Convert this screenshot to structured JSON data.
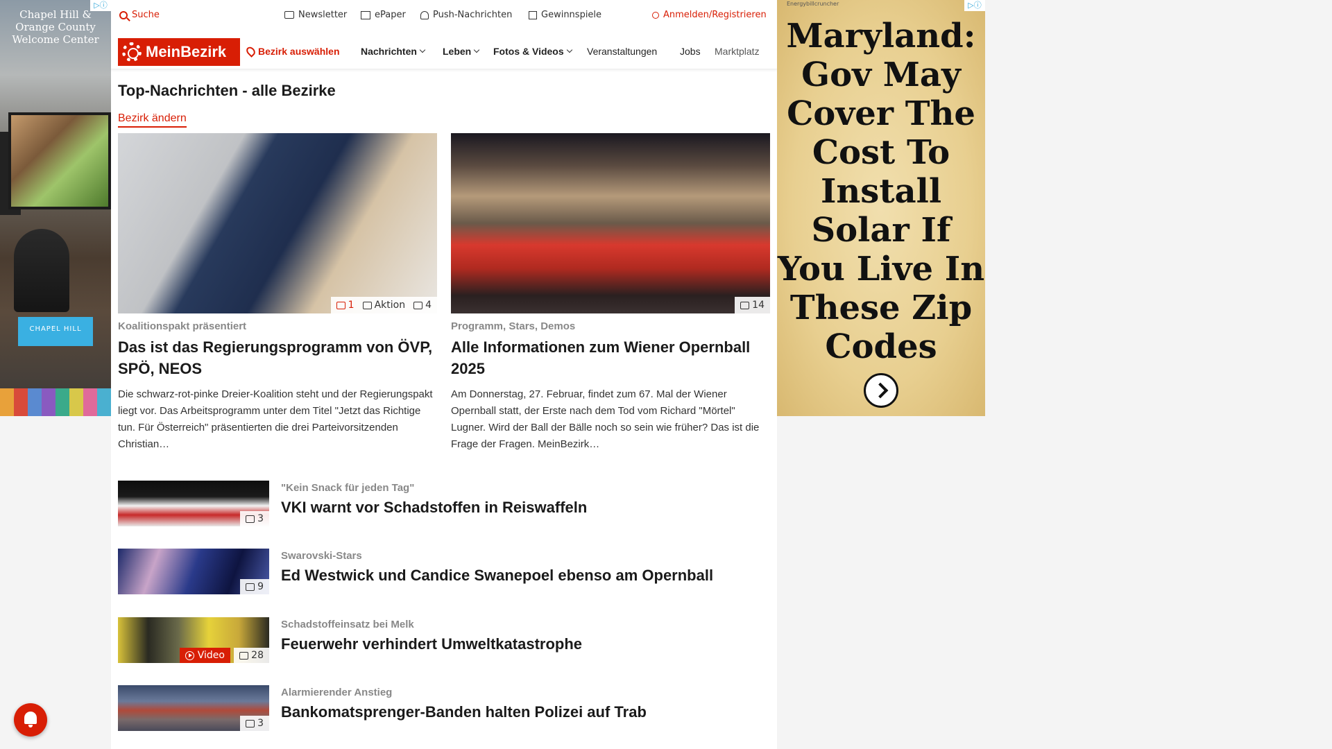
{
  "left_ad": {
    "title": "Chapel Hill & Orange County Welcome Center",
    "logo": "CHAPEL HILL",
    "adchoice": "▷ⓘ",
    "stripe_colors": [
      "#e8a13a",
      "#d84a3a",
      "#5a8ad0",
      "#8a5ac0",
      "#3aaa8a",
      "#d8c84a",
      "#e06a9a",
      "#4ab0d0"
    ]
  },
  "topbar": {
    "search": "Suche",
    "newsletter": "Newsletter",
    "epaper": "ePaper",
    "push": "Push-Nachrichten",
    "gewinnspiele": "Gewinnspiele",
    "login": "Anmelden/Registrieren"
  },
  "nav": {
    "logo": "MeinBezirk",
    "bezirk": "Bezirk auswählen",
    "items": [
      "Nachrichten",
      "Leben",
      "Fotos & Videos",
      "Veranstaltungen",
      "Jobs",
      "Marktplatz"
    ]
  },
  "page": {
    "title": "Top-Nachrichten - alle Bezirke",
    "bezirk_link": "Bezirk ändern"
  },
  "cards": [
    {
      "kicker": "Koalitionspakt präsentiert",
      "headline": "Das ist das Regierungsprogramm von ÖVP, SPÖ, NEOS",
      "teaser": "Die schwarz-rot-pinke Dreier-Koalition steht und der Regierungspakt liegt vor. Das Arbeitsprogramm unter dem Titel \"Jetzt das Richtige tun. Für Österreich\" präsentierten die drei Parteivorsitzenden Christian…",
      "comments": "1",
      "aktion": "Aktion",
      "photos": "4"
    },
    {
      "kicker": "Programm, Stars, Demos",
      "headline": "Alle Informationen zum Wiener Opernball 2025",
      "teaser": "Am Donnerstag, 27. Februar, findet zum 67. Mal der Wiener Opernball statt, der Erste nach dem Tod vom Richard \"Mörtel\" Lugner. Wird der Ball der Bälle noch so sein wie früher? Das ist die Frage der Fragen. MeinBezirk…",
      "photos": "14"
    }
  ],
  "list": [
    {
      "kicker": "\"Kein Snack für jeden Tag\"",
      "headline": "VKI warnt vor Schadstoffen in Reiswaffeln",
      "photos": "3"
    },
    {
      "kicker": "Swarovski-Stars",
      "headline": "Ed Westwick und Candice Swanepoel ebenso am Opernball",
      "photos": "9"
    },
    {
      "kicker": "Schadstoffeinsatz bei Melk",
      "headline": "Feuerwehr verhindert Umweltkatastrophe",
      "photos": "28",
      "video": "Video"
    },
    {
      "kicker": "Alarmierender Anstieg",
      "headline": "Bankomatsprenger-Banden halten Polizei auf Trab",
      "photos": "3"
    }
  ],
  "right_ad": {
    "source": "Energybillcruncher",
    "headline": "Maryland: Gov May Cover The Cost To Install Solar If You Live In These Zip Codes",
    "adchoice": "▷ⓘ"
  }
}
